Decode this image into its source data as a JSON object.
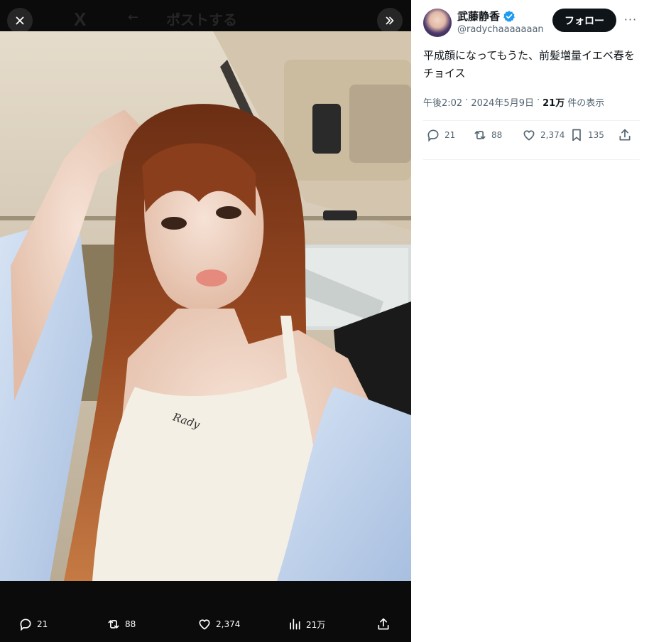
{
  "media_view": {
    "ghost_header": {
      "logo": "X",
      "back_arrow": "←",
      "title": "ポストする"
    },
    "actions": {
      "replies": "21",
      "reposts": "88",
      "likes": "2,374",
      "views": "21万"
    },
    "photo_print_text": "Rady"
  },
  "post": {
    "author": {
      "display_name": "武藤静香",
      "handle": "@radychaaaaaaan",
      "verified": true
    },
    "follow_label": "フォロー",
    "more_label": "···",
    "text": "平成顔になってもうた、前髪増量イエベ春をチョイス",
    "meta": {
      "time": "午後2:02",
      "separator": "·",
      "date": "2024年5月9日",
      "separator2": "·",
      "views_count": "21万",
      "views_label": "件の表示"
    },
    "actions": {
      "replies": "21",
      "reposts": "88",
      "likes": "2,374",
      "bookmarks": "135"
    }
  },
  "colors": {
    "accent_blue": "#1d9bf0",
    "text_primary": "#0f1419",
    "text_secondary": "#536471",
    "media_background": "#0b0b0b",
    "divider": "#eff3f4"
  },
  "icons": [
    "close-icon",
    "expand-icon",
    "reply-icon",
    "repost-icon",
    "like-icon",
    "views-icon",
    "share-icon",
    "bookmark-icon",
    "verified-badge-icon",
    "more-icon"
  ]
}
